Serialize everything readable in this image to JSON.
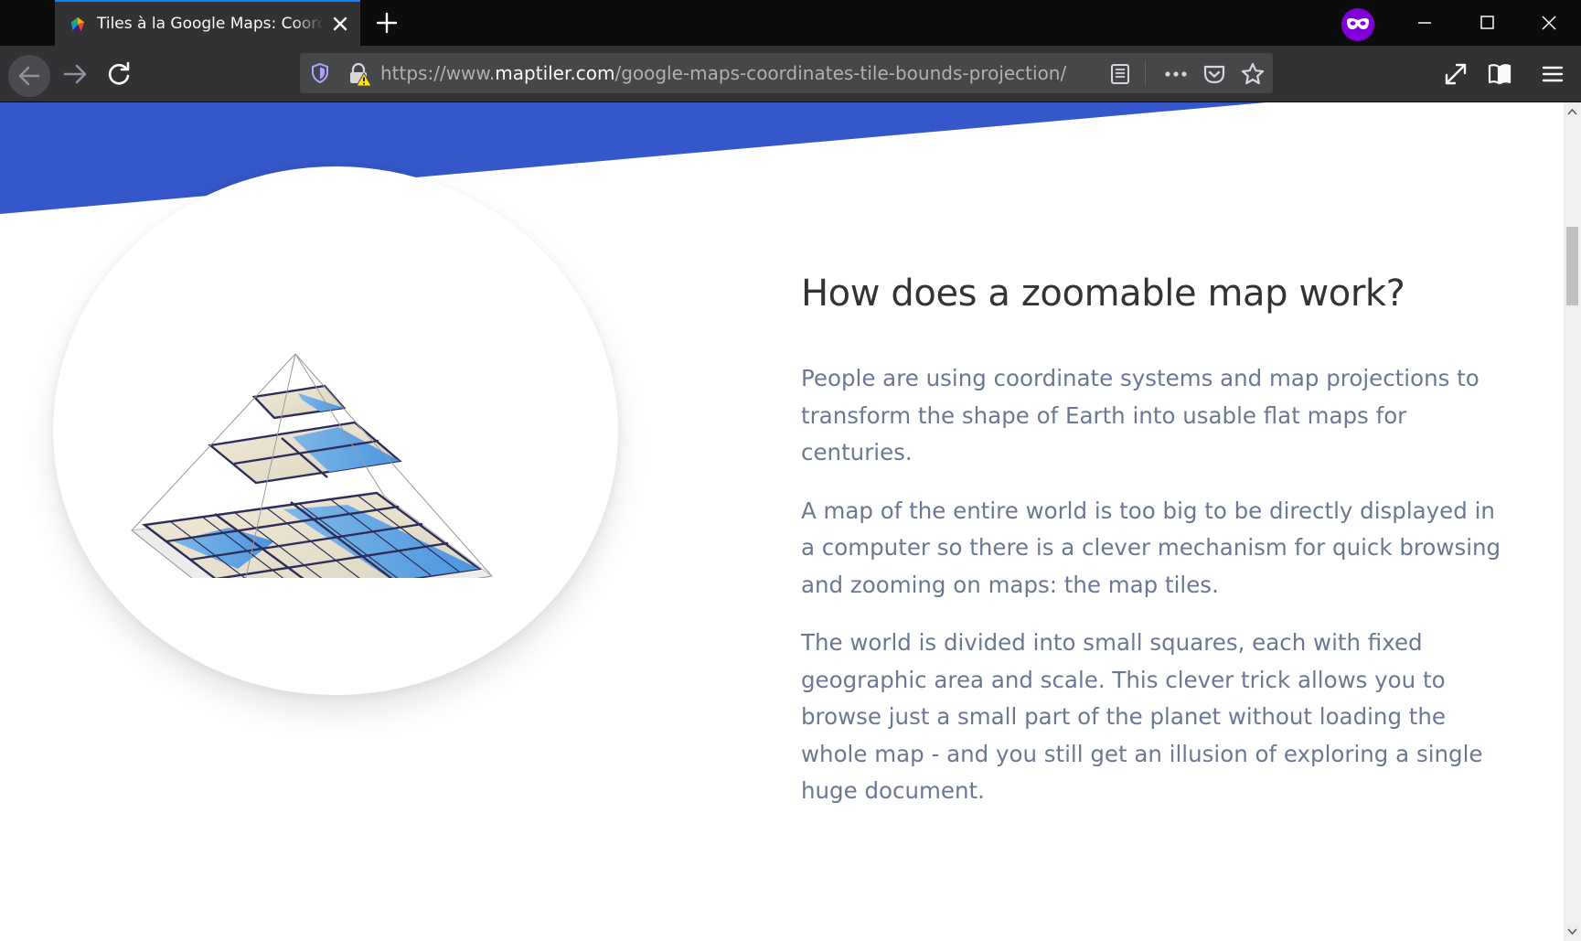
{
  "browser": {
    "tab": {
      "title": "Tiles à la Google Maps: Coordinates, Tile Bounds and Projection",
      "favicon": "maptiler-logo-icon"
    },
    "url": {
      "prefix": "https://www.",
      "domain": "maptiler.com",
      "path": "/google-maps-coordinates-tile-bounds-projection/"
    },
    "icons": [
      "back-arrow-icon",
      "forward-arrow-icon",
      "reload-icon",
      "tracking-shield-icon",
      "insecure-lock-icon",
      "reader-view-icon",
      "more-dots-icon",
      "pocket-icon",
      "bookmark-star-icon",
      "fullscreen-icon",
      "library-icon",
      "hamburger-menu-icon",
      "private-browsing-mask-icon",
      "close-icon",
      "plus-icon"
    ],
    "colors": {
      "accent": "#0a84ff",
      "private": "#8000d7"
    }
  },
  "page": {
    "banner_color": "#3557c9",
    "illustration": "zoomable-map-tile-pyramid",
    "heading": "How does a zoomable map work?",
    "paragraphs": [
      "People are using coordinate systems and map projections to transform the shape of Earth into usable flat maps for centuries.",
      "A map of the entire world is too big to be directly displayed in a computer so there is a clever mechanism for quick browsing and zooming on maps: the map tiles.",
      "The world is divided into small squares, each with fixed geographic area and scale. This clever trick allows you to browse just a small part of the planet without loading the whole map - and you still get an illusion of exploring a single huge document."
    ],
    "text_color": "#6b7894"
  }
}
